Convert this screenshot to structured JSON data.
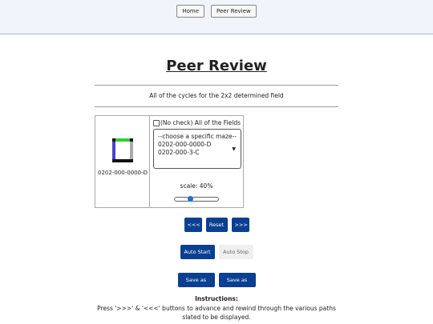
{
  "nav": {
    "home_label": "Home",
    "peer_review_label": "Peer Review"
  },
  "page": {
    "title": "Peer Review",
    "subtitle": "All of the cycles for the 2x2 determined field"
  },
  "panel": {
    "maze_caption": "0202-000-0000-D",
    "checkbox_label": "(No check) All of the Fields",
    "checkbox_checked": false,
    "select_options": [
      "--choose a specific maze--",
      "0202-000-0000-D",
      "0202-000-3-C"
    ],
    "scale_label": "scale: 40%",
    "scale_fraction": 0.35
  },
  "controls": {
    "prev_label": "<<<",
    "reset_label": "Reset",
    "next_label": ">>>",
    "auto_start_label": "Auto Start",
    "auto_stop_label": "Auto Stop",
    "save_svg_label": "Save as SVG",
    "save_png_label": "Save as PNG"
  },
  "instructions": {
    "title": "Instructions:",
    "text": "Press '>>>' & '<<<' buttons to advance and rewind through the various paths slated to be displayed."
  },
  "colors": {
    "button_blue": "#0b3f91",
    "slider_thumb": "#1a6fd8",
    "maze_green": "#2fd02f",
    "maze_blue": "#4b3fd6",
    "maze_black": "#111111",
    "maze_gray": "#aaaaaa"
  }
}
